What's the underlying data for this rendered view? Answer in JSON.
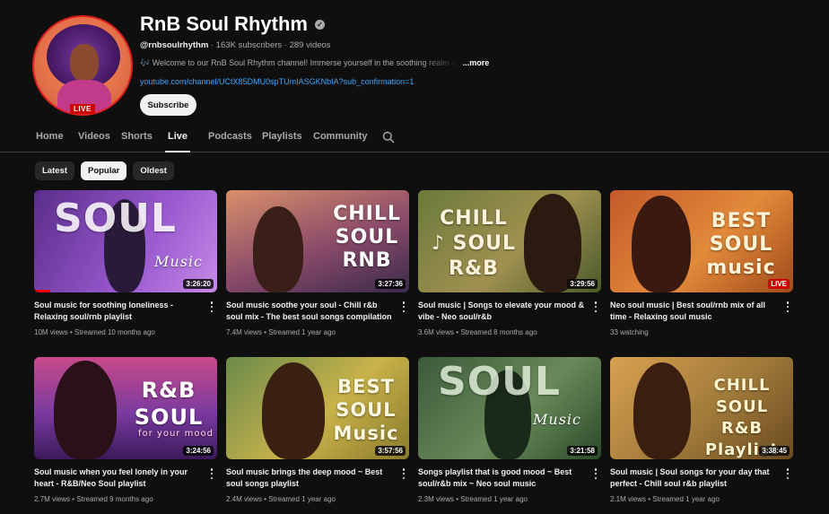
{
  "channel": {
    "name": "RnB Soul Rhythm",
    "handle": "@rnbsoulrhythm",
    "subscribers": "163K subscribers",
    "videos_count": "289 videos",
    "separator": "·",
    "description": "🎶 Welcome to our RnB Soul Rhythm channel! Immerse yourself in the soothing realm of",
    "more_label": "...more",
    "link": "youtube.com/channel/UCtX85DMU0spTUmIASGKNbIA?sub_confirmation=1",
    "subscribe_label": "Subscribe",
    "live_badge": "LIVE"
  },
  "tabs": [
    "Home",
    "Videos",
    "Shorts",
    "Live",
    "Podcasts",
    "Playlists",
    "Community"
  ],
  "active_tab": "Live",
  "chips": [
    "Latest",
    "Popular",
    "Oldest"
  ],
  "active_chip": "Popular",
  "videos": [
    {
      "art": "SOUL",
      "art_sub": "Music",
      "duration": "3:26:20",
      "title": "Soul music for soothing loneliness - Relaxing soul/rnb playlist",
      "views": "10M views",
      "age": "Streamed 10 months ago",
      "watched_fraction": 0.1
    },
    {
      "art": "CHILL SOUL RNB",
      "art_sub": "",
      "duration": "3:27:36",
      "title": "Soul music soothe your soul - Chill r&b soul mix - The best soul songs compilation",
      "views": "7.4M views",
      "age": "Streamed 1 year ago"
    },
    {
      "art": "CHILL ♪ SOUL R&B",
      "art_sub": "",
      "duration": "3:29:56",
      "title": "Soul music | Songs to elevate your mood & vibe - Neo soul/r&b",
      "views": "3.6M views",
      "age": "Streamed 8 months ago"
    },
    {
      "art": "BEST SOUL music",
      "art_sub": "",
      "duration": "LIVE",
      "title": "Neo soul music | Best soul/rnb mix of all time - Relaxing soul music",
      "views": "33 watching",
      "age": ""
    },
    {
      "art": "R&B SOUL",
      "art_sub": "for your mood",
      "duration": "3:24:56",
      "title": "Soul music when you feel lonely in your heart - R&B/Neo Soul playlist",
      "views": "2.7M views",
      "age": "Streamed 9 months ago"
    },
    {
      "art": "BEST SOUL Music",
      "art_sub": "",
      "duration": "3:57:56",
      "title": "Soul music brings the deep mood ~ Best soul songs playlist",
      "views": "2.4M views",
      "age": "Streamed 1 year ago"
    },
    {
      "art": "SOUL",
      "art_sub": "Music",
      "duration": "3:21:58",
      "title": "Songs playlist that is good mood ~ Best soul/r&b mix ~ Neo soul music",
      "views": "2.3M views",
      "age": "Streamed 1 year ago"
    },
    {
      "art": "CHILL SOUL R&B Playlist",
      "art_sub": "",
      "duration": "3:38:45",
      "title": "Soul music | Soul songs for your day that perfect - Chill soul r&b playlist",
      "views": "2.1M views",
      "age": "Streamed 1 year ago"
    }
  ],
  "colors": {
    "background": "#0f0f0f",
    "link": "#3ea6ff",
    "live_red": "#cc0000"
  }
}
